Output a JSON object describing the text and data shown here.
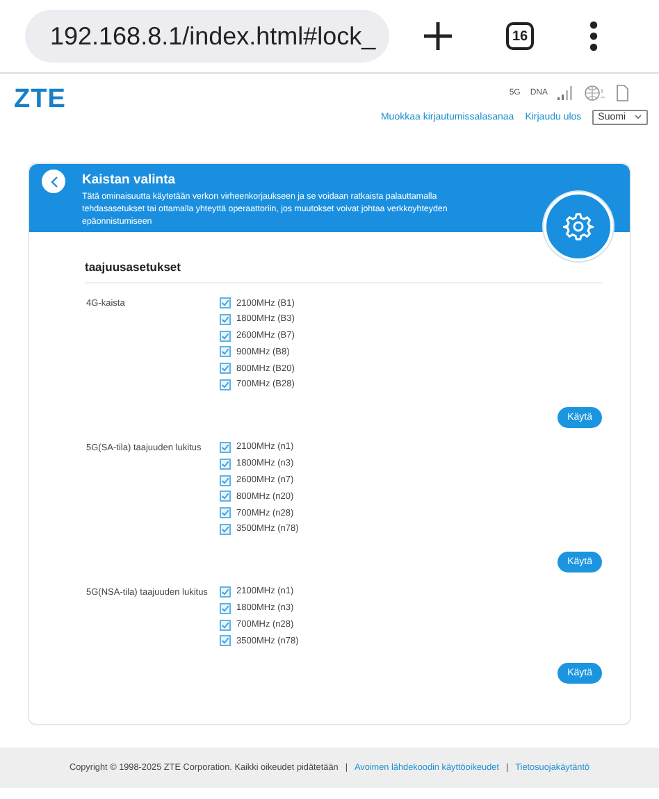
{
  "browser": {
    "url": "192.168.8.1/index.html#lock_",
    "tab_count": "16"
  },
  "header": {
    "logo": "ZTE",
    "status": [
      "5G",
      "DNA"
    ],
    "links": [
      "Muokkaa kirjautumissalasanaa",
      "Kirjaudu ulos"
    ],
    "language": "Suomi"
  },
  "panel": {
    "title": "Kaistan valinta",
    "description": "Tätä ominaisuutta käytetään verkon virheenkorjaukseen ja se voidaan ratkaista palauttamalla tehdasasetukset tai ottamalla yhteyttä operaattoriin, jos muutokset voivat johtaa verkkoyhteyden epäonnistumiseen",
    "section_title": "taajuusasetukset",
    "groups": [
      {
        "label": "4G-kaista",
        "button": "Käytä",
        "bands": [
          {
            "label": "2100MHz (B1)",
            "checked": true
          },
          {
            "label": "1800MHz (B3)",
            "checked": true
          },
          {
            "label": "2600MHz (B7)",
            "checked": true
          },
          {
            "label": "900MHz (B8)",
            "checked": true
          },
          {
            "label": "800MHz (B20)",
            "checked": true
          },
          {
            "label": "700MHz (B28)",
            "checked": true
          }
        ]
      },
      {
        "label": "5G(SA-tila) taajuuden lukitus",
        "button": "Käytä",
        "bands": [
          {
            "label": "2100MHz (n1)",
            "checked": true
          },
          {
            "label": "1800MHz (n3)",
            "checked": true
          },
          {
            "label": "2600MHz (n7)",
            "checked": true
          },
          {
            "label": "800MHz (n20)",
            "checked": true
          },
          {
            "label": "700MHz (n28)",
            "checked": true
          },
          {
            "label": "3500MHz (n78)",
            "checked": true
          }
        ]
      },
      {
        "label": "5G(NSA-tila) taajuuden lukitus",
        "button": "Käytä",
        "bands": [
          {
            "label": "2100MHz (n1)",
            "checked": true
          },
          {
            "label": "1800MHz (n3)",
            "checked": true
          },
          {
            "label": "700MHz (n28)",
            "checked": true
          },
          {
            "label": "3500MHz (n78)",
            "checked": true
          }
        ]
      }
    ]
  },
  "footer": {
    "copyright": "Copyright © 1998-2025 ZTE Corporation. Kaikki oikeudet pidätetään",
    "separators": [
      "|",
      "|"
    ],
    "links": [
      "Avoimen lähdekoodin käyttöoikeudet",
      "Tietosuojakäytäntö"
    ]
  }
}
